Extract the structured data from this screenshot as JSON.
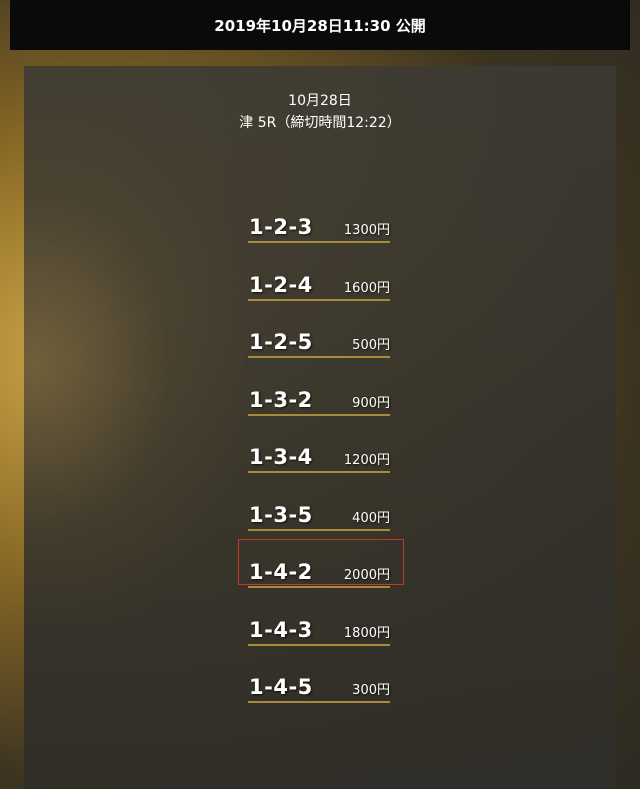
{
  "header": {
    "title": "2019年10月28日11:30 公開"
  },
  "info": {
    "date": "10月28日",
    "race": "津 5R（締切時間12:22）"
  },
  "bets": [
    {
      "combo": "1-2-3",
      "amount": "1300円"
    },
    {
      "combo": "1-2-4",
      "amount": "1600円"
    },
    {
      "combo": "1-2-5",
      "amount": "500円"
    },
    {
      "combo": "1-3-2",
      "amount": "900円"
    },
    {
      "combo": "1-3-4",
      "amount": "1200円"
    },
    {
      "combo": "1-3-5",
      "amount": "400円"
    },
    {
      "combo": "1-4-2",
      "amount": "2000円"
    },
    {
      "combo": "1-4-3",
      "amount": "1800円"
    },
    {
      "combo": "1-4-5",
      "amount": "300円"
    }
  ],
  "highlight": {
    "color": "#c0392b",
    "bet_index": 6
  },
  "colors": {
    "underline": "#a88a3c",
    "header_bg": "#0a0a0a",
    "text": "#ffffff"
  }
}
